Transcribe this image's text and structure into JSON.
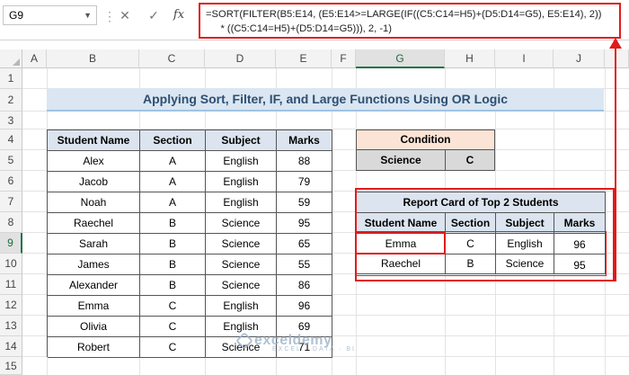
{
  "formula_bar": {
    "name_box": "G9",
    "cancel_icon": "x-icon",
    "enter_icon": "check-icon",
    "fx_label": "fx",
    "formula_line1": "=SORT(FILTER(B5:E14, (E5:E14>=LARGE(IF((C5:C14=H5)+(D5:D14=G5), E5:E14), 2))",
    "formula_line2": "* ((C5:C14=H5)+(D5:D14=G5))), 2, -1)"
  },
  "columns": [
    "A",
    "B",
    "C",
    "D",
    "E",
    "F",
    "G",
    "H",
    "I",
    "J"
  ],
  "selected_column": "G",
  "rows": [
    "1",
    "2",
    "3",
    "4",
    "5",
    "6",
    "7",
    "8",
    "9",
    "10",
    "11",
    "12",
    "13",
    "14",
    "15"
  ],
  "selected_row": "9",
  "title": "Applying Sort, Filter, IF, and Large Functions Using OR Logic",
  "main_table": {
    "headers": [
      "Student Name",
      "Section",
      "Subject",
      "Marks"
    ],
    "rows": [
      [
        "Alex",
        "A",
        "English",
        "88"
      ],
      [
        "Jacob",
        "A",
        "English",
        "79"
      ],
      [
        "Noah",
        "A",
        "English",
        "59"
      ],
      [
        "Raechel",
        "B",
        "Science",
        "95"
      ],
      [
        "Sarah",
        "B",
        "Science",
        "65"
      ],
      [
        "James",
        "B",
        "Science",
        "55"
      ],
      [
        "Alexander",
        "B",
        "Science",
        "86"
      ],
      [
        "Emma",
        "C",
        "English",
        "96"
      ],
      [
        "Olivia",
        "C",
        "English",
        "69"
      ],
      [
        "Robert",
        "C",
        "Science",
        "71"
      ]
    ]
  },
  "condition": {
    "header": "Condition",
    "subject": "Science",
    "section": "C"
  },
  "report": {
    "title": "Report Card of Top 2 Students",
    "headers": [
      "Student Name",
      "Section",
      "Subject",
      "Marks"
    ],
    "rows": [
      [
        "Emma",
        "C",
        "English",
        "96"
      ],
      [
        "Raechel",
        "B",
        "Science",
        "95"
      ]
    ]
  },
  "watermark": {
    "name": "exceldemy",
    "tagline": "EXCEL · DATA · BI"
  },
  "colors": {
    "highlight": "#e11b1b",
    "table_header": "#dbe4ef",
    "condition_header": "#fbe4d5",
    "excel_green": "#217346"
  }
}
